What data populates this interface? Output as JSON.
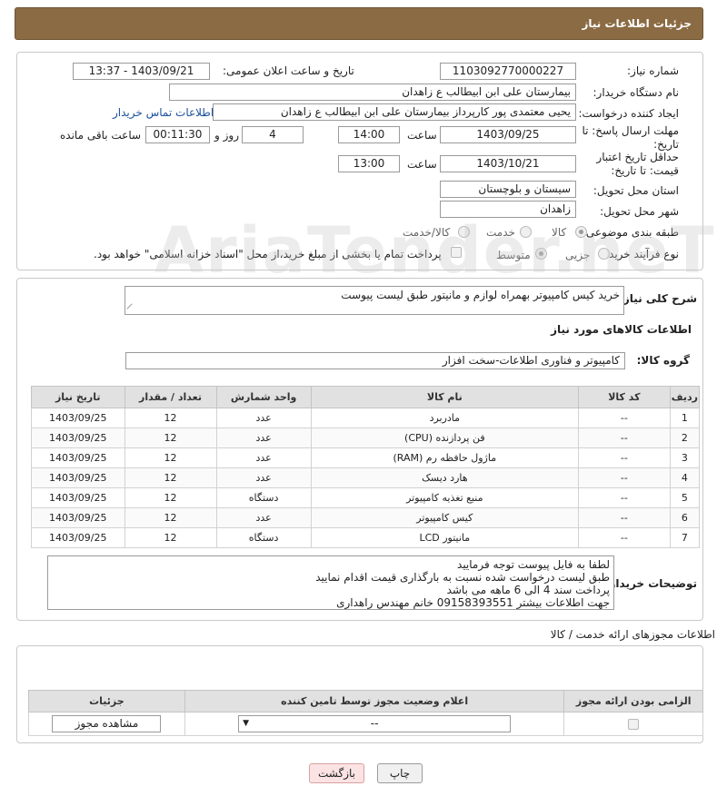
{
  "header": {
    "title": "جزئیات اطلاعات نیاز"
  },
  "form": {
    "need_number_label": "شماره نیاز:",
    "need_number": "1103092770000227",
    "announce_label": "تاریخ و ساعت اعلان عمومی:",
    "announce_value": "1403/09/21 - 13:37",
    "buyer_org_label": "نام دستگاه خریدار:",
    "buyer_org": "بیمارستان علی ابن ابیطالب  ع  زاهدان",
    "requester_label": "ایجاد کننده درخواست:",
    "requester": "یحیی معتمدی پور کارپرداز بیمارستان علی ابن ابیطالب  ع  زاهدان",
    "buyer_contact_link": "اطلاعات تماس خریدار",
    "deadline_label": "مهلت ارسال پاسخ: تا تاریخ:",
    "deadline_date": "1403/09/25",
    "hour_label": "ساعت",
    "deadline_time": "14:00",
    "days_value": "4",
    "days_label": "روز و",
    "remaining_time": "00:11:30",
    "remaining_label": "ساعت باقی مانده",
    "validity_label": "حداقل تاریخ اعتبار قیمت: تا تاریخ:",
    "validity_date": "1403/10/21",
    "validity_time": "13:00",
    "province_label": "استان محل تحویل:",
    "province": "سیستان و بلوچستان",
    "city_label": "شهر محل تحویل:",
    "city": "زاهدان",
    "category_label": "طبقه بندی موضوعی:",
    "category_options": [
      "کالا",
      "خدمت",
      "کالا/خدمت"
    ],
    "process_label": "نوع فرآیند خرید :",
    "process_options": [
      "جزیی",
      "متوسط"
    ],
    "process_note": "پرداخت تمام یا بخشی از مبلغ خرید،از محل \"اسناد خزانه اسلامی\" خواهد بود."
  },
  "goods": {
    "desc_label": "شرح کلی نیاز:",
    "desc_value": "خرید کیس کامپیوتر بهمراه لوازم و مانیتور طبق لیست پیوست",
    "section_title": "اطلاعات کالاهای مورد نیاز",
    "group_label": "گروه کالا:",
    "group_value": "کامپیوتر و فناوری اطلاعات-سخت افزار",
    "columns": [
      "ردیف",
      "کد کالا",
      "نام کالا",
      "واحد شمارش",
      "تعداد / مقدار",
      "تاریخ نیاز"
    ],
    "rows": [
      [
        "1",
        "--",
        "مادربرد",
        "عدد",
        "12",
        "1403/09/25"
      ],
      [
        "2",
        "--",
        "فن پردازنده (CPU)",
        "عدد",
        "12",
        "1403/09/25"
      ],
      [
        "3",
        "--",
        "ماژول حافظه رم (RAM)",
        "عدد",
        "12",
        "1403/09/25"
      ],
      [
        "4",
        "--",
        "هارد دیسک",
        "عدد",
        "12",
        "1403/09/25"
      ],
      [
        "5",
        "--",
        "منبع تغذیه کامپیوتر",
        "دستگاه",
        "12",
        "1403/09/25"
      ],
      [
        "6",
        "--",
        "کیس کامپیوتر",
        "عدد",
        "12",
        "1403/09/25"
      ],
      [
        "7",
        "--",
        "مانیتور LCD",
        "دستگاه",
        "12",
        "1403/09/25"
      ]
    ],
    "buyer_notes_label": "توضیحات خریدار:",
    "buyer_notes": [
      "لطفا به فایل پیوست توجه فرمایید",
      "طبق لیست درخواست شده نسبت به بارگذاری قیمت اقدام نمایید",
      "پرداخت سند 4 الی 6 ماهه می باشد",
      "جهت اطلاعات بیشتر 09158393551 خانم مهندس راهداری"
    ]
  },
  "permits": {
    "section_title": "اطلاعات مجوزهای ارائه خدمت / کالا",
    "columns": [
      "الزامی بودن ارائه مجوز",
      "اعلام وضعیت مجوز توسط تامین کننده",
      "جزئیات"
    ],
    "select_value": "--",
    "view_button": "مشاهده مجوز"
  },
  "footer": {
    "print_button": "چاپ",
    "back_button": "بازگشت"
  },
  "watermark": "AriaTender.neT"
}
